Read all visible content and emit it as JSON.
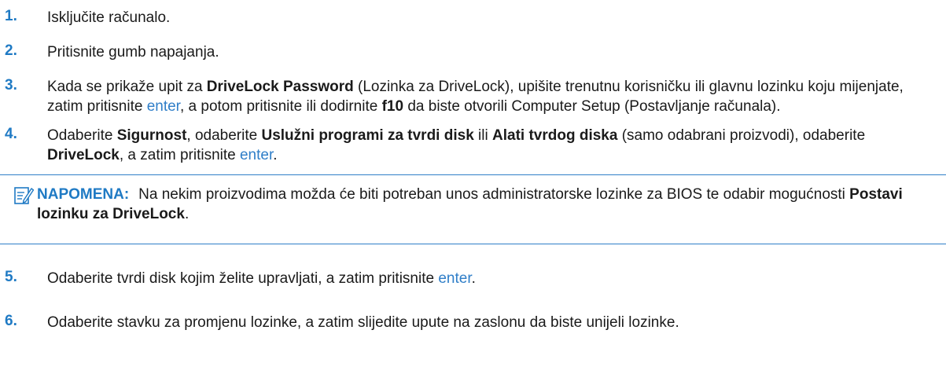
{
  "colors": {
    "accent": "#1f7ac4",
    "key": "#2f7ec8",
    "text": "#1a1a1a"
  },
  "steps": [
    {
      "num": "1.",
      "text": "Isključite računalo."
    },
    {
      "num": "2.",
      "text": "Pritisnite gumb napajanja."
    },
    {
      "num": "3.",
      "t1": "Kada se prikaže upit za ",
      "b1": "DriveLock Password",
      "t2": " (Lozinka za DriveLock), upišite trenutnu korisničku ili glavnu lozinku koju mijenjate, zatim pritisnite ",
      "k1": "enter",
      "t3": ", a potom pritisnite ili dodirnite ",
      "b2": "f10",
      "t4": " da biste otvorili Computer Setup (Postavljanje računala)."
    },
    {
      "num": "4.",
      "t1": "Odaberite ",
      "b1": "Sigurnost",
      "t2": ", odaberite ",
      "b2": "Uslužni programi za tvrdi disk",
      "t3": " ili ",
      "b3": "Alati tvrdog diska",
      "t4": " (samo odabrani proizvodi), odaberite ",
      "b4": "DriveLock",
      "t5": ", a zatim pritisnite ",
      "k1": "enter",
      "t6": "."
    },
    {
      "num": "5.",
      "t1": "Odaberite tvrdi disk kojim želite upravljati, a zatim pritisnite ",
      "k1": "enter",
      "t2": "."
    },
    {
      "num": "6.",
      "text": "Odaberite stavku za promjenu lozinke, a zatim slijedite upute na zaslonu da biste unijeli lozinke."
    }
  ],
  "note": {
    "icon": "note-pencil-icon",
    "label": "NAPOMENA:",
    "t1": "Na nekim proizvodima možda će biti potreban unos administratorske lozinke za BIOS te odabir mogućnosti ",
    "b1": "Postavi lozinku za DriveLock",
    "t2": "."
  }
}
